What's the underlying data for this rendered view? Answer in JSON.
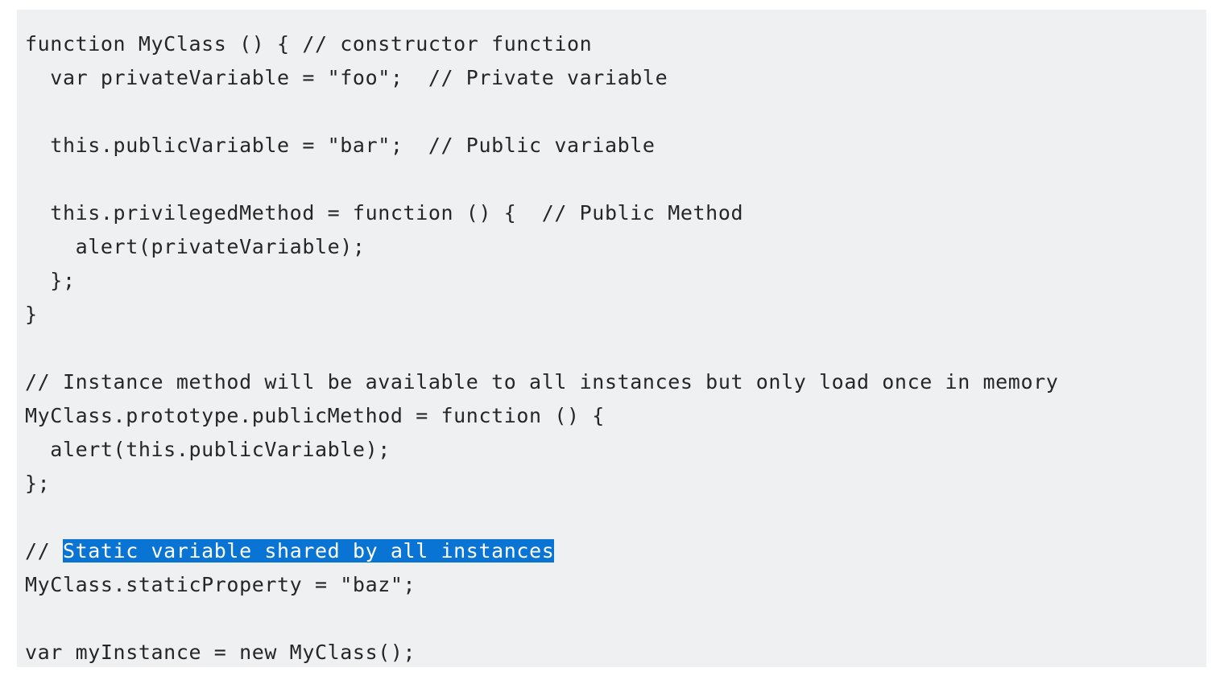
{
  "code": {
    "lines": [
      "function MyClass () { // constructor function",
      "  var privateVariable = \"foo\";  // Private variable",
      "",
      "  this.publicVariable = \"bar\";  // Public variable",
      "",
      "  this.privilegedMethod = function () {  // Public Method",
      "    alert(privateVariable);",
      "  };",
      "}",
      "",
      "// Instance method will be available to all instances but only load once in memory",
      "MyClass.prototype.publicMethod = function () {",
      "  alert(this.publicVariable);",
      "};",
      "",
      "// ",
      "MyClass.staticProperty = \"baz\";",
      "",
      "var myInstance = new MyClass();"
    ],
    "selected_text": "Static variable shared by all instances"
  },
  "colors": {
    "code_background": "#eff0f1",
    "code_text": "#242729",
    "selection_background": "#0a74d4",
    "selection_text": "#ffffff"
  }
}
